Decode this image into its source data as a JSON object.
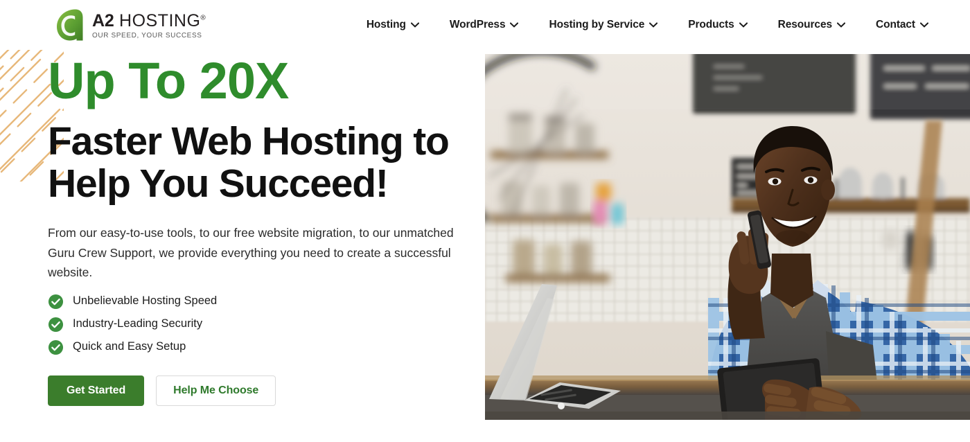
{
  "brand": {
    "logo_icon": "a2-logo-mark",
    "name_bold": "A2",
    "name_light": " HOSTING",
    "registered": "®",
    "tagline": "OUR SPEED, YOUR SUCCESS",
    "green": "#2f8c2c",
    "dark": "#231f20"
  },
  "nav": {
    "items": [
      {
        "label": "Hosting",
        "icon": "chevron-down-icon"
      },
      {
        "label": "WordPress",
        "icon": "chevron-down-icon"
      },
      {
        "label": "Hosting by Service",
        "icon": "chevron-down-icon"
      },
      {
        "label": "Products",
        "icon": "chevron-down-icon"
      },
      {
        "label": "Resources",
        "icon": "chevron-down-icon"
      },
      {
        "label": "Contact",
        "icon": "chevron-down-icon"
      }
    ]
  },
  "hero": {
    "headline_green": "Up To 20X",
    "headline_line1": "Faster Web Hosting to",
    "headline_line2": "Help You Succeed!",
    "paragraph": "From our easy-to-use tools, to our free website migration, to our unmatched Guru Crew Support, we provide everything you need to create a successful website.",
    "features": [
      {
        "label": "Unbelievable Hosting Speed",
        "icon": "check-circle-icon"
      },
      {
        "label": "Industry-Leading Security",
        "icon": "check-circle-icon"
      },
      {
        "label": "Quick and Easy Setup",
        "icon": "check-circle-icon"
      }
    ],
    "primary_cta": "Get Started",
    "secondary_cta": "Help Me Choose",
    "primary_cta_color": "#3b7d2c",
    "secondary_cta_color": "#2f7a2c",
    "image_alt": "Smiling cafe worker in blue plaid shirt and grey apron holding a tablet and talking on a phone behind a counter with a laptop",
    "decoration": "diagonal-dashed-lines"
  }
}
